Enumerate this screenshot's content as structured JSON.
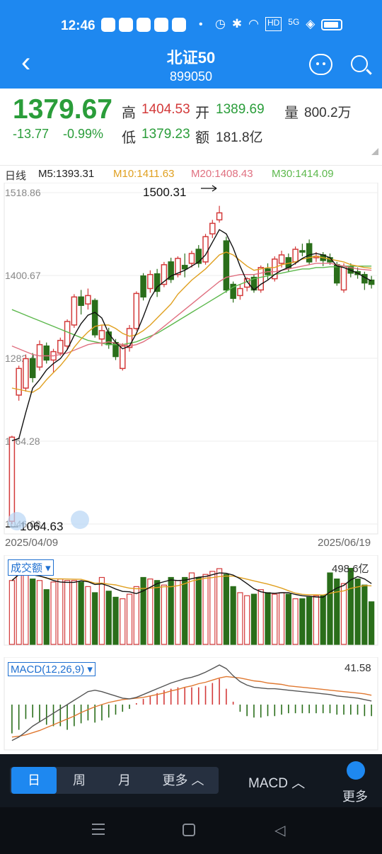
{
  "status": {
    "time": "12:46",
    "network": "5G"
  },
  "header": {
    "title": "北证50",
    "code": "899050"
  },
  "quote": {
    "price": "1379.67",
    "change": "-13.77",
    "change_pct": "-0.99%",
    "high_label": "高",
    "high": "1404.53",
    "open_label": "开",
    "open": "1389.69",
    "volume_label": "量",
    "volume": "800.2万",
    "low_label": "低",
    "low": "1379.23",
    "amount_label": "额",
    "amount": "181.8亿"
  },
  "ma_legend": {
    "period": "日线",
    "m5": "M5:1393.31",
    "m10": "M10:1411.63",
    "m20": "M20:1408.43",
    "m30": "M30:1414.09"
  },
  "colors": {
    "up": "#d33a3a",
    "down": "#2a6e1a",
    "m5": "#111111",
    "m10": "#e0a020",
    "m20": "#e07080",
    "m30": "#5cb84c",
    "accent": "#1e88f0"
  },
  "chart_data": [
    {
      "type": "candlestick",
      "y_ticks": [
        "1518.86",
        "1400.67",
        "1282.47",
        "1164.28",
        "1046.08"
      ],
      "ylim": [
        1046.08,
        1518.86
      ],
      "x_range": [
        "2025/04/09",
        "2025/06/19"
      ],
      "annotations": {
        "max": "1500.31",
        "min": "1064.63"
      },
      "candles": [
        [
          1050,
          1170,
          1046,
          1172
        ],
        [
          1230,
          1268,
          1222,
          1272
        ],
        [
          1240,
          1282,
          1235,
          1288
        ],
        [
          1282,
          1255,
          1248,
          1290
        ],
        [
          1270,
          1302,
          1265,
          1308
        ],
        [
          1300,
          1280,
          1275,
          1305
        ],
        [
          1280,
          1292,
          1262,
          1296
        ],
        [
          1290,
          1308,
          1286,
          1312
        ],
        [
          1300,
          1335,
          1295,
          1338
        ],
        [
          1330,
          1370,
          1326,
          1374
        ],
        [
          1370,
          1358,
          1345,
          1380
        ],
        [
          1360,
          1372,
          1352,
          1382
        ],
        [
          1365,
          1316,
          1312,
          1368
        ],
        [
          1310,
          1322,
          1300,
          1330
        ],
        [
          1320,
          1302,
          1296,
          1326
        ],
        [
          1305,
          1285,
          1280,
          1310
        ],
        [
          1268,
          1300,
          1265,
          1304
        ],
        [
          1298,
          1325,
          1292,
          1330
        ],
        [
          1325,
          1375,
          1322,
          1378
        ],
        [
          1400,
          1370,
          1365,
          1404
        ],
        [
          1382,
          1402,
          1376,
          1408
        ],
        [
          1403,
          1378,
          1370,
          1410
        ],
        [
          1388,
          1416,
          1384,
          1420
        ],
        [
          1420,
          1395,
          1390,
          1426
        ],
        [
          1402,
          1425,
          1398,
          1428
        ],
        [
          1415,
          1410,
          1398,
          1432
        ],
        [
          1418,
          1432,
          1412,
          1436
        ],
        [
          1438,
          1418,
          1412,
          1444
        ],
        [
          1420,
          1456,
          1416,
          1460
        ],
        [
          1460,
          1475,
          1454,
          1480
        ],
        [
          1480,
          1490,
          1476,
          1500
        ],
        [
          1450,
          1380,
          1376,
          1456
        ],
        [
          1388,
          1368,
          1362,
          1392
        ],
        [
          1372,
          1382,
          1366,
          1388
        ],
        [
          1384,
          1396,
          1378,
          1398
        ],
        [
          1398,
          1380,
          1376,
          1402
        ],
        [
          1380,
          1412,
          1376,
          1415
        ],
        [
          1410,
          1402,
          1395,
          1418
        ],
        [
          1396,
          1424,
          1392,
          1428
        ],
        [
          1418,
          1430,
          1412,
          1436
        ],
        [
          1426,
          1412,
          1406,
          1432
        ],
        [
          1420,
          1438,
          1416,
          1442
        ],
        [
          1436,
          1434,
          1428,
          1446
        ],
        [
          1446,
          1420,
          1416,
          1452
        ],
        [
          1426,
          1428,
          1420,
          1434
        ],
        [
          1430,
          1422,
          1414,
          1434
        ],
        [
          1426,
          1420,
          1416,
          1432
        ],
        [
          1416,
          1390,
          1386,
          1420
        ],
        [
          1380,
          1414,
          1376,
          1418
        ],
        [
          1414,
          1404,
          1398,
          1418
        ],
        [
          1406,
          1402,
          1396,
          1412
        ],
        [
          1402,
          1390,
          1380,
          1406
        ],
        [
          1394,
          1388,
          1382,
          1400
        ]
      ],
      "ma5": [
        1165,
        1168,
        1205,
        1240,
        1252,
        1266,
        1275,
        1282,
        1295,
        1315,
        1332,
        1344,
        1348,
        1340,
        1318,
        1305,
        1296,
        1300,
        1318,
        1342,
        1368,
        1384,
        1392,
        1400,
        1404,
        1408,
        1414,
        1420,
        1430,
        1448,
        1466,
        1460,
        1440,
        1414,
        1392,
        1380,
        1388,
        1394,
        1402,
        1408,
        1412,
        1418,
        1425,
        1430,
        1432,
        1430,
        1426,
        1414,
        1412,
        1408,
        1404,
        1398,
        1393
      ],
      "ma10": [
        1240,
        1238,
        1236,
        1234,
        1240,
        1252,
        1262,
        1272,
        1284,
        1298,
        1310,
        1320,
        1328,
        1330,
        1330,
        1325,
        1318,
        1314,
        1316,
        1322,
        1330,
        1340,
        1350,
        1360,
        1374,
        1384,
        1394,
        1402,
        1410,
        1420,
        1430,
        1434,
        1430,
        1422,
        1414,
        1408,
        1410,
        1412,
        1412,
        1416,
        1418,
        1420,
        1424,
        1426,
        1428,
        1426,
        1424,
        1422,
        1420,
        1416,
        1414,
        1412,
        1411
      ],
      "ma20": [
        1300,
        1296,
        1292,
        1288,
        1286,
        1286,
        1286,
        1288,
        1290,
        1294,
        1298,
        1302,
        1304,
        1304,
        1306,
        1304,
        1302,
        1300,
        1302,
        1306,
        1312,
        1320,
        1328,
        1336,
        1344,
        1352,
        1360,
        1368,
        1376,
        1384,
        1392,
        1398,
        1400,
        1402,
        1402,
        1402,
        1404,
        1406,
        1406,
        1408,
        1410,
        1412,
        1414,
        1416,
        1418,
        1418,
        1418,
        1416,
        1414,
        1412,
        1410,
        1409,
        1408
      ],
      "ma30": [
        1352,
        1348,
        1344,
        1340,
        1336,
        1332,
        1328,
        1324,
        1320,
        1316,
        1312,
        1308,
        1306,
        1304,
        1302,
        1302,
        1302,
        1304,
        1306,
        1310,
        1314,
        1318,
        1324,
        1330,
        1336,
        1342,
        1348,
        1354,
        1360,
        1366,
        1372,
        1378,
        1384,
        1388,
        1392,
        1396,
        1398,
        1400,
        1402,
        1404,
        1406,
        1408,
        1410,
        1410,
        1412,
        1412,
        1413,
        1413,
        1414,
        1414,
        1414,
        1414,
        1414
      ]
    },
    {
      "type": "bar",
      "title": "成交额",
      "label_max": "498.6亿",
      "ylim": [
        0,
        540
      ],
      "volumes": [
        420,
        498,
        480,
        430,
        420,
        360,
        410,
        430,
        420,
        420,
        410,
        380,
        340,
        440,
        350,
        310,
        300,
        330,
        380,
        440,
        430,
        420,
        390,
        440,
        420,
        440,
        470,
        440,
        460,
        480,
        498,
        460,
        380,
        340,
        320,
        330,
        360,
        340,
        330,
        340,
        330,
        300,
        300,
        310,
        320,
        320,
        470,
        430,
        400,
        500,
        430,
        390,
        280
      ]
    },
    {
      "type": "macd",
      "title": "MACD(12,26,9)",
      "label_max": "41.58",
      "ylim": [
        -60,
        60
      ],
      "dif": [
        -50,
        -45,
        -38,
        -30,
        -24,
        -18,
        -12,
        -6,
        0,
        6,
        12,
        18,
        20,
        18,
        15,
        12,
        9,
        8,
        10,
        14,
        18,
        22,
        26,
        30,
        33,
        36,
        38,
        41,
        45,
        50,
        55,
        50,
        40,
        32,
        27,
        24,
        23,
        22,
        22,
        21,
        20,
        19,
        18,
        17,
        16,
        15,
        14,
        12,
        11,
        10,
        9,
        7,
        5
      ],
      "dea": [
        -45,
        -44,
        -42,
        -39,
        -36,
        -32,
        -28,
        -24,
        -20,
        -16,
        -11,
        -7,
        -3,
        0,
        3,
        5,
        7,
        8,
        9,
        10,
        12,
        14,
        16,
        19,
        21,
        24,
        26,
        29,
        31,
        34,
        37,
        39,
        38,
        37,
        35,
        33,
        32,
        30,
        29,
        28,
        26,
        25,
        24,
        23,
        22,
        21,
        20,
        19,
        18,
        17,
        16,
        15,
        13
      ],
      "hist": [
        -40,
        -35,
        -20,
        -18,
        -24,
        -28,
        -30,
        -30,
        -35,
        -30,
        -26,
        -22,
        -25,
        -22,
        -18,
        -14,
        -10,
        -6,
        2,
        8,
        12,
        16,
        20,
        22,
        24,
        24,
        24,
        24,
        26,
        30,
        36,
        22,
        4,
        -10,
        -16,
        -18,
        -18,
        -16,
        -16,
        -14,
        -12,
        -12,
        -12,
        -12,
        -12,
        -12,
        -12,
        -14,
        -14,
        -14,
        -14,
        -16,
        -16
      ]
    }
  ],
  "dates": {
    "start": "2025/04/09",
    "end": "2025/06/19"
  },
  "bottom": {
    "periods": [
      "日",
      "周",
      "月",
      "更多"
    ],
    "indicator": "MACD",
    "more": "更多"
  }
}
